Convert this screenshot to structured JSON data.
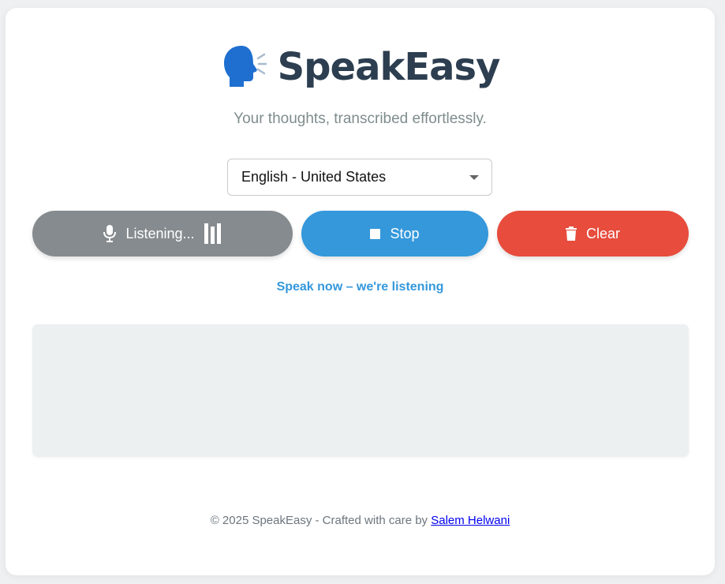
{
  "app": {
    "title": "SpeakEasy",
    "tagline": "Your thoughts, transcribed effortlessly.",
    "logo_icon": "speaking-head-icon"
  },
  "language": {
    "selected": "English - United States"
  },
  "buttons": {
    "listen": {
      "label": "Listening...",
      "icon": "microphone-icon",
      "indicator": "sound-bars-icon"
    },
    "stop": {
      "label": "Stop",
      "icon": "stop-square-icon"
    },
    "clear": {
      "label": "Clear",
      "icon": "trash-icon"
    }
  },
  "status": "Speak now – we're listening",
  "transcript": "",
  "footer": {
    "text": "© 2025 SpeakEasy - Crafted with care by",
    "author": "Salem Helwani"
  },
  "colors": {
    "brand_text": "#2c3e50",
    "accent_blue": "#3498db",
    "danger_red": "#e74c3c",
    "listening_gray": "#868b8f",
    "transcript_bg": "#ecf0f1"
  }
}
